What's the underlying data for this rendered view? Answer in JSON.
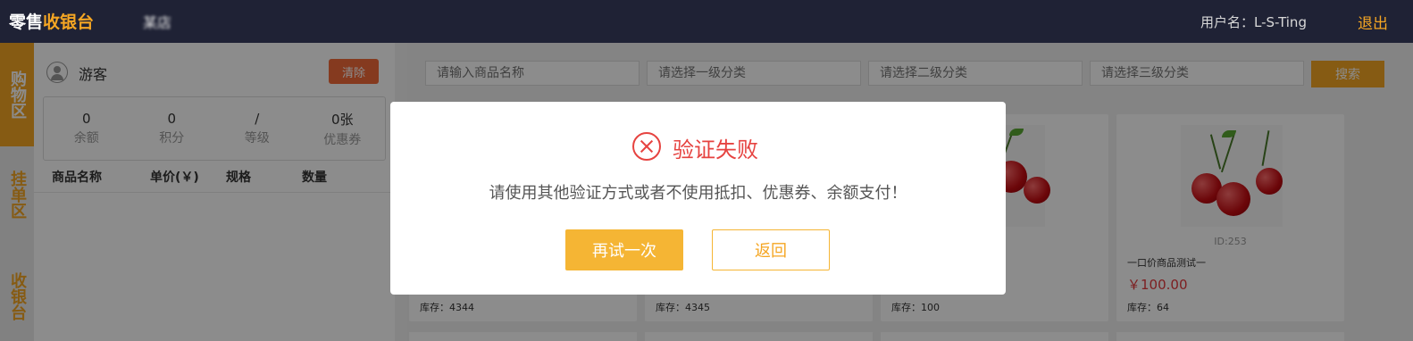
{
  "header": {
    "brand_part1": "零售",
    "brand_part2": "收银台",
    "store_name": "某店",
    "user_label": "用户名：L-S-Ting",
    "logout_label": "退出"
  },
  "side_nav": {
    "items": [
      {
        "label": "购物区",
        "active": true
      },
      {
        "label": "挂单区",
        "active": false
      },
      {
        "label": "收银台",
        "active": false
      }
    ]
  },
  "cart": {
    "guest_name": "游客",
    "clear_label": "清除",
    "stats": [
      {
        "value": "0",
        "label": "余额"
      },
      {
        "value": "0",
        "label": "积分"
      },
      {
        "value": "/",
        "label": "等级"
      },
      {
        "value": "0张",
        "label": "优惠券"
      }
    ],
    "columns": [
      "商品名称",
      "单价(￥)",
      "规格",
      "数量"
    ]
  },
  "search": {
    "name_placeholder": "请输入商品名称",
    "cat1_placeholder": "请选择一级分类",
    "cat2_placeholder": "请选择二级分类",
    "cat3_placeholder": "请选择三级分类",
    "search_label": "搜索"
  },
  "products": [
    {
      "id_label": "",
      "name": "",
      "price": "",
      "stock": "库存：4344"
    },
    {
      "id_label": "",
      "name": "",
      "price": "",
      "stock": "库存：4345"
    },
    {
      "id_label": "",
      "name": "",
      "price": "",
      "stock": "库存：100"
    },
    {
      "id_label": "ID:253",
      "name": "一口价商品测试一",
      "price": "￥100.00",
      "stock": "库存：64"
    }
  ],
  "modal": {
    "icon": "close-circle-icon",
    "title": "验证失败",
    "message": "请使用其他验证方式或者不使用抵扣、优惠券、余额支付！",
    "retry_label": "再试一次",
    "back_label": "返回"
  },
  "colors": {
    "accent": "#f5a623",
    "header_bg": "#1f2235",
    "error": "#e64340",
    "price": "#e4393c"
  }
}
